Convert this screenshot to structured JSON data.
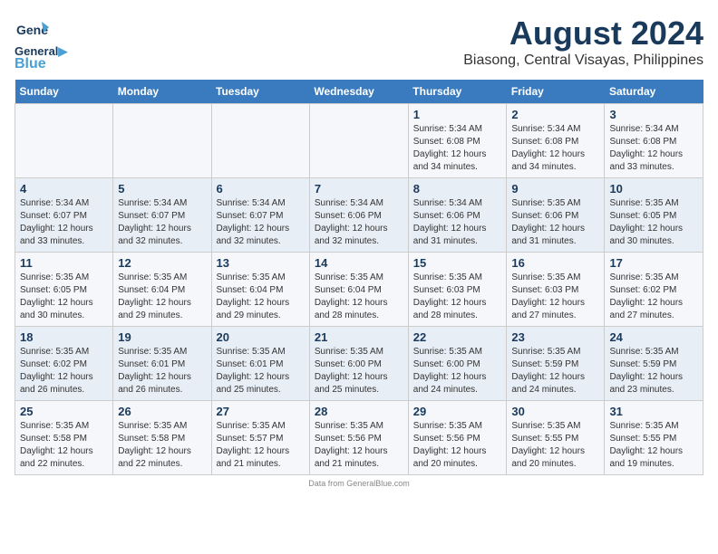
{
  "logo": {
    "general": "General",
    "blue": "Blue"
  },
  "title": "August 2024",
  "subtitle": "Biasong, Central Visayas, Philippines",
  "days_of_week": [
    "Sunday",
    "Monday",
    "Tuesday",
    "Wednesday",
    "Thursday",
    "Friday",
    "Saturday"
  ],
  "weeks": [
    [
      {
        "day": "",
        "info": ""
      },
      {
        "day": "",
        "info": ""
      },
      {
        "day": "",
        "info": ""
      },
      {
        "day": "",
        "info": ""
      },
      {
        "day": "1",
        "info": "Sunrise: 5:34 AM\nSunset: 6:08 PM\nDaylight: 12 hours and 34 minutes."
      },
      {
        "day": "2",
        "info": "Sunrise: 5:34 AM\nSunset: 6:08 PM\nDaylight: 12 hours and 34 minutes."
      },
      {
        "day": "3",
        "info": "Sunrise: 5:34 AM\nSunset: 6:08 PM\nDaylight: 12 hours and 33 minutes."
      }
    ],
    [
      {
        "day": "4",
        "info": "Sunrise: 5:34 AM\nSunset: 6:07 PM\nDaylight: 12 hours and 33 minutes."
      },
      {
        "day": "5",
        "info": "Sunrise: 5:34 AM\nSunset: 6:07 PM\nDaylight: 12 hours and 32 minutes."
      },
      {
        "day": "6",
        "info": "Sunrise: 5:34 AM\nSunset: 6:07 PM\nDaylight: 12 hours and 32 minutes."
      },
      {
        "day": "7",
        "info": "Sunrise: 5:34 AM\nSunset: 6:06 PM\nDaylight: 12 hours and 32 minutes."
      },
      {
        "day": "8",
        "info": "Sunrise: 5:34 AM\nSunset: 6:06 PM\nDaylight: 12 hours and 31 minutes."
      },
      {
        "day": "9",
        "info": "Sunrise: 5:35 AM\nSunset: 6:06 PM\nDaylight: 12 hours and 31 minutes."
      },
      {
        "day": "10",
        "info": "Sunrise: 5:35 AM\nSunset: 6:05 PM\nDaylight: 12 hours and 30 minutes."
      }
    ],
    [
      {
        "day": "11",
        "info": "Sunrise: 5:35 AM\nSunset: 6:05 PM\nDaylight: 12 hours and 30 minutes."
      },
      {
        "day": "12",
        "info": "Sunrise: 5:35 AM\nSunset: 6:04 PM\nDaylight: 12 hours and 29 minutes."
      },
      {
        "day": "13",
        "info": "Sunrise: 5:35 AM\nSunset: 6:04 PM\nDaylight: 12 hours and 29 minutes."
      },
      {
        "day": "14",
        "info": "Sunrise: 5:35 AM\nSunset: 6:04 PM\nDaylight: 12 hours and 28 minutes."
      },
      {
        "day": "15",
        "info": "Sunrise: 5:35 AM\nSunset: 6:03 PM\nDaylight: 12 hours and 28 minutes."
      },
      {
        "day": "16",
        "info": "Sunrise: 5:35 AM\nSunset: 6:03 PM\nDaylight: 12 hours and 27 minutes."
      },
      {
        "day": "17",
        "info": "Sunrise: 5:35 AM\nSunset: 6:02 PM\nDaylight: 12 hours and 27 minutes."
      }
    ],
    [
      {
        "day": "18",
        "info": "Sunrise: 5:35 AM\nSunset: 6:02 PM\nDaylight: 12 hours and 26 minutes."
      },
      {
        "day": "19",
        "info": "Sunrise: 5:35 AM\nSunset: 6:01 PM\nDaylight: 12 hours and 26 minutes."
      },
      {
        "day": "20",
        "info": "Sunrise: 5:35 AM\nSunset: 6:01 PM\nDaylight: 12 hours and 25 minutes."
      },
      {
        "day": "21",
        "info": "Sunrise: 5:35 AM\nSunset: 6:00 PM\nDaylight: 12 hours and 25 minutes."
      },
      {
        "day": "22",
        "info": "Sunrise: 5:35 AM\nSunset: 6:00 PM\nDaylight: 12 hours and 24 minutes."
      },
      {
        "day": "23",
        "info": "Sunrise: 5:35 AM\nSunset: 5:59 PM\nDaylight: 12 hours and 24 minutes."
      },
      {
        "day": "24",
        "info": "Sunrise: 5:35 AM\nSunset: 5:59 PM\nDaylight: 12 hours and 23 minutes."
      }
    ],
    [
      {
        "day": "25",
        "info": "Sunrise: 5:35 AM\nSunset: 5:58 PM\nDaylight: 12 hours and 22 minutes."
      },
      {
        "day": "26",
        "info": "Sunrise: 5:35 AM\nSunset: 5:58 PM\nDaylight: 12 hours and 22 minutes."
      },
      {
        "day": "27",
        "info": "Sunrise: 5:35 AM\nSunset: 5:57 PM\nDaylight: 12 hours and 21 minutes."
      },
      {
        "day": "28",
        "info": "Sunrise: 5:35 AM\nSunset: 5:56 PM\nDaylight: 12 hours and 21 minutes."
      },
      {
        "day": "29",
        "info": "Sunrise: 5:35 AM\nSunset: 5:56 PM\nDaylight: 12 hours and 20 minutes."
      },
      {
        "day": "30",
        "info": "Sunrise: 5:35 AM\nSunset: 5:55 PM\nDaylight: 12 hours and 20 minutes."
      },
      {
        "day": "31",
        "info": "Sunrise: 5:35 AM\nSunset: 5:55 PM\nDaylight: 12 hours and 19 minutes."
      }
    ]
  ]
}
